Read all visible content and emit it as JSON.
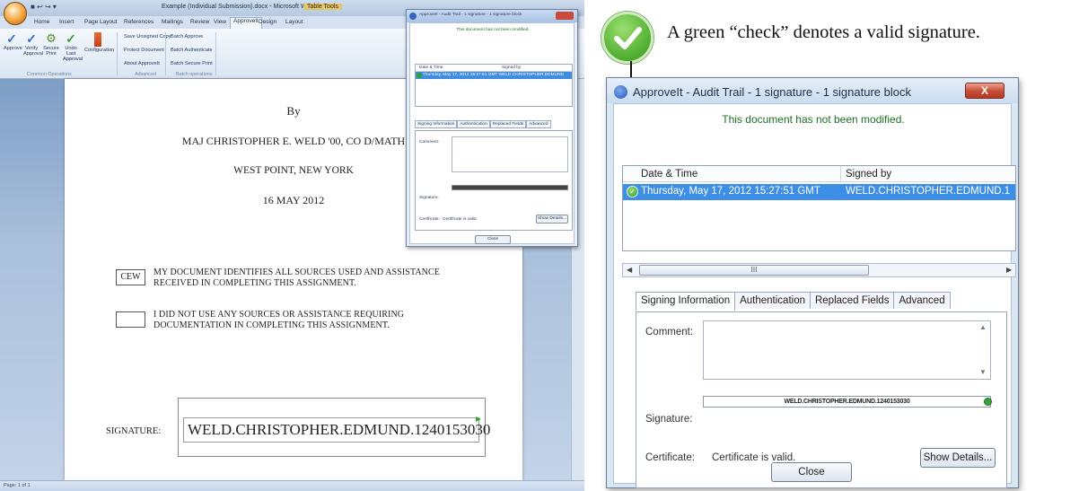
{
  "word": {
    "window_title": "Example (Individual Submission).docx - Microsoft Word",
    "context_title": "Table Tools",
    "tabs": [
      "Home",
      "Insert",
      "Page Layout",
      "References",
      "Mailings",
      "Review",
      "View",
      "ApproveIt",
      "Design",
      "Layout"
    ],
    "ribbon": {
      "approve": "Approve",
      "verify": "Verify Approval",
      "secure": "Secure Print",
      "undo": "Undo Last Approval",
      "config": "Configuration",
      "save_unsigned": "Save Unsigned Copy",
      "protect": "Protect Document",
      "about": "About ApproveIt",
      "batch_approve": "Batch Approve",
      "batch_auth": "Batch Authenticate",
      "batch_print": "Batch Secure Print",
      "group_common": "Common Operations",
      "group_advanced": "Advanced",
      "group_batch": "Batch operations"
    },
    "document": {
      "by": "By",
      "author": "MAJ CHRISTOPHER E. WELD '00, CO D/MATH",
      "place": "WEST POINT, NEW YORK",
      "date": "16 MAY 2012",
      "initials": "CEW",
      "statement1_line1": "MY DOCUMENT IDENTIFIES  ALL SOURCES USED AND ASSISTANCE",
      "statement1_line2": "RECEIVED IN COMPLETING THIS ASSIGNMENT.",
      "statement2_line1": "I DID NOT USE ANY SOURCES OR ASSISTANCE REQUIRING",
      "statement2_line2": "DOCUMENTATION IN COMPLETING THIS ASSIGNMENT.",
      "signature_label": "SIGNATURE:",
      "signature_value": "WELD.CHRISTOPHER.EDMUND.1240153030"
    },
    "status": "Page: 1 of 1",
    "mini_dialog": {
      "title": "ApproveIt - Audit Trail - 1 signature - 1 signature block",
      "message": "This document has not been modified.",
      "col_date": "Date & Time",
      "col_signer": "Signed by",
      "row": "Thursday, May 17, 2012 15:27:51 GMT   WELD.CHRISTOPHER.EDMUND",
      "tabs": [
        "Signing Information",
        "Authentication",
        "Replaced Fields",
        "Advanced"
      ],
      "comment": "Comment:",
      "signature": "Signature:",
      "certificate": "Certificate:",
      "cert_value": "Certificate is valid.",
      "show_details": "Show Details...",
      "close": "Close"
    }
  },
  "annotation": {
    "text": "A green “check” denotes a valid signature.",
    "check_color": "#4fae2f"
  },
  "dialog": {
    "title": "ApproveIt - Audit Trail - 1 signature - 1 signature block",
    "close_x": "X",
    "status_message": "This document has not been modified.",
    "columns": {
      "date": "Date & Time",
      "signer": "Signed by"
    },
    "rows": [
      {
        "date": "Thursday, May 17, 2012 15:27:51 GMT",
        "signer": "WELD.CHRISTOPHER.EDMUND.1"
      }
    ],
    "scroll_thumb": "III",
    "tabs": [
      "Signing Information",
      "Authentication",
      "Replaced Fields",
      "Advanced"
    ],
    "comment_label": "Comment:",
    "signature_label": "Signature:",
    "signature_strip": "WELD.CHRISTOPHER.EDMUND.1240153030",
    "certificate_label": "Certificate:",
    "certificate_value": "Certificate is valid.",
    "show_details": "Show Details...",
    "close": "Close",
    "selected_color": "#3d8ee6",
    "valid_color": "#38a23a"
  }
}
